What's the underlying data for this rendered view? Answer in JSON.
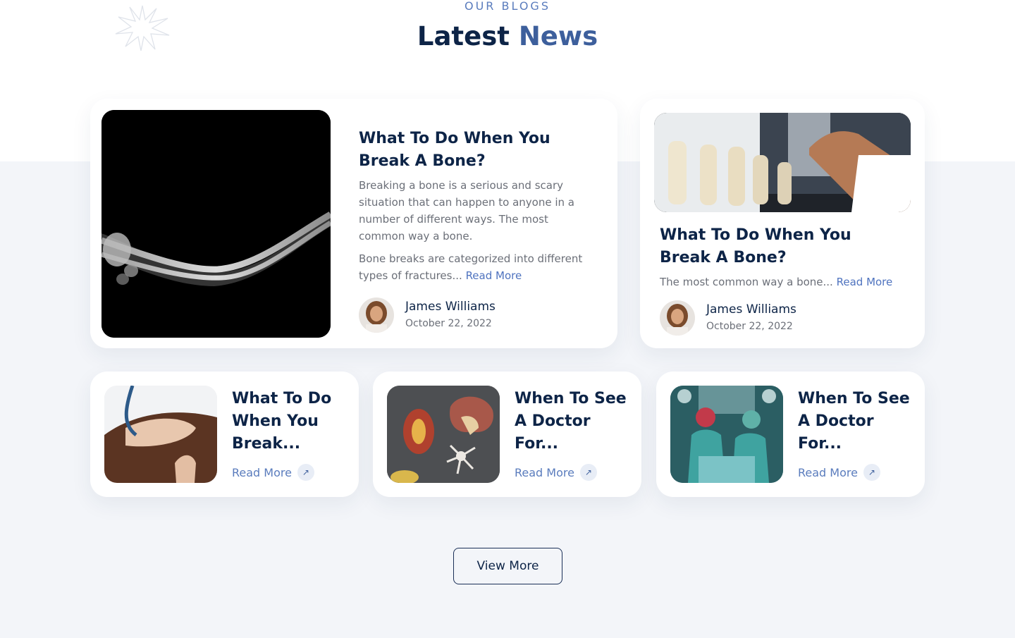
{
  "section": {
    "eyebrow": "OUR BLOGS",
    "title_part1": "Latest",
    "title_part2": "News"
  },
  "featured": {
    "title": "What To Do When You Break A Bone?",
    "excerpt_p1": "Breaking a bone is a serious and scary situation that can happen to anyone in a number of different ways. The most common way a bone.",
    "excerpt_p2": " Bone breaks are categorized into different types of fractures...",
    "read_more": "Read More",
    "author": "James Williams",
    "date": "October 22, 2022",
    "image_icon": "arm-xray-image"
  },
  "secondary": {
    "title": "What To Do When You Break A Bone?",
    "excerpt": "The most common way a bone...",
    "read_more": "Read More",
    "author": "James Williams",
    "date": "October 22, 2022",
    "image_icon": "knee-models-image"
  },
  "small_cards": [
    {
      "title": "What To Do When You Break...",
      "read_more": "Read More",
      "image_icon": "hands-stethoscope-image"
    },
    {
      "title": "When To See A Doctor For...",
      "read_more": "Read More",
      "image_icon": "organ-models-image"
    },
    {
      "title": "When To See A Doctor For...",
      "read_more": "Read More",
      "image_icon": "surgery-image"
    }
  ],
  "view_more": "View More",
  "colors": {
    "navy": "#0d2447",
    "accent": "#4f73bf",
    "background": "#f3f5f9"
  }
}
